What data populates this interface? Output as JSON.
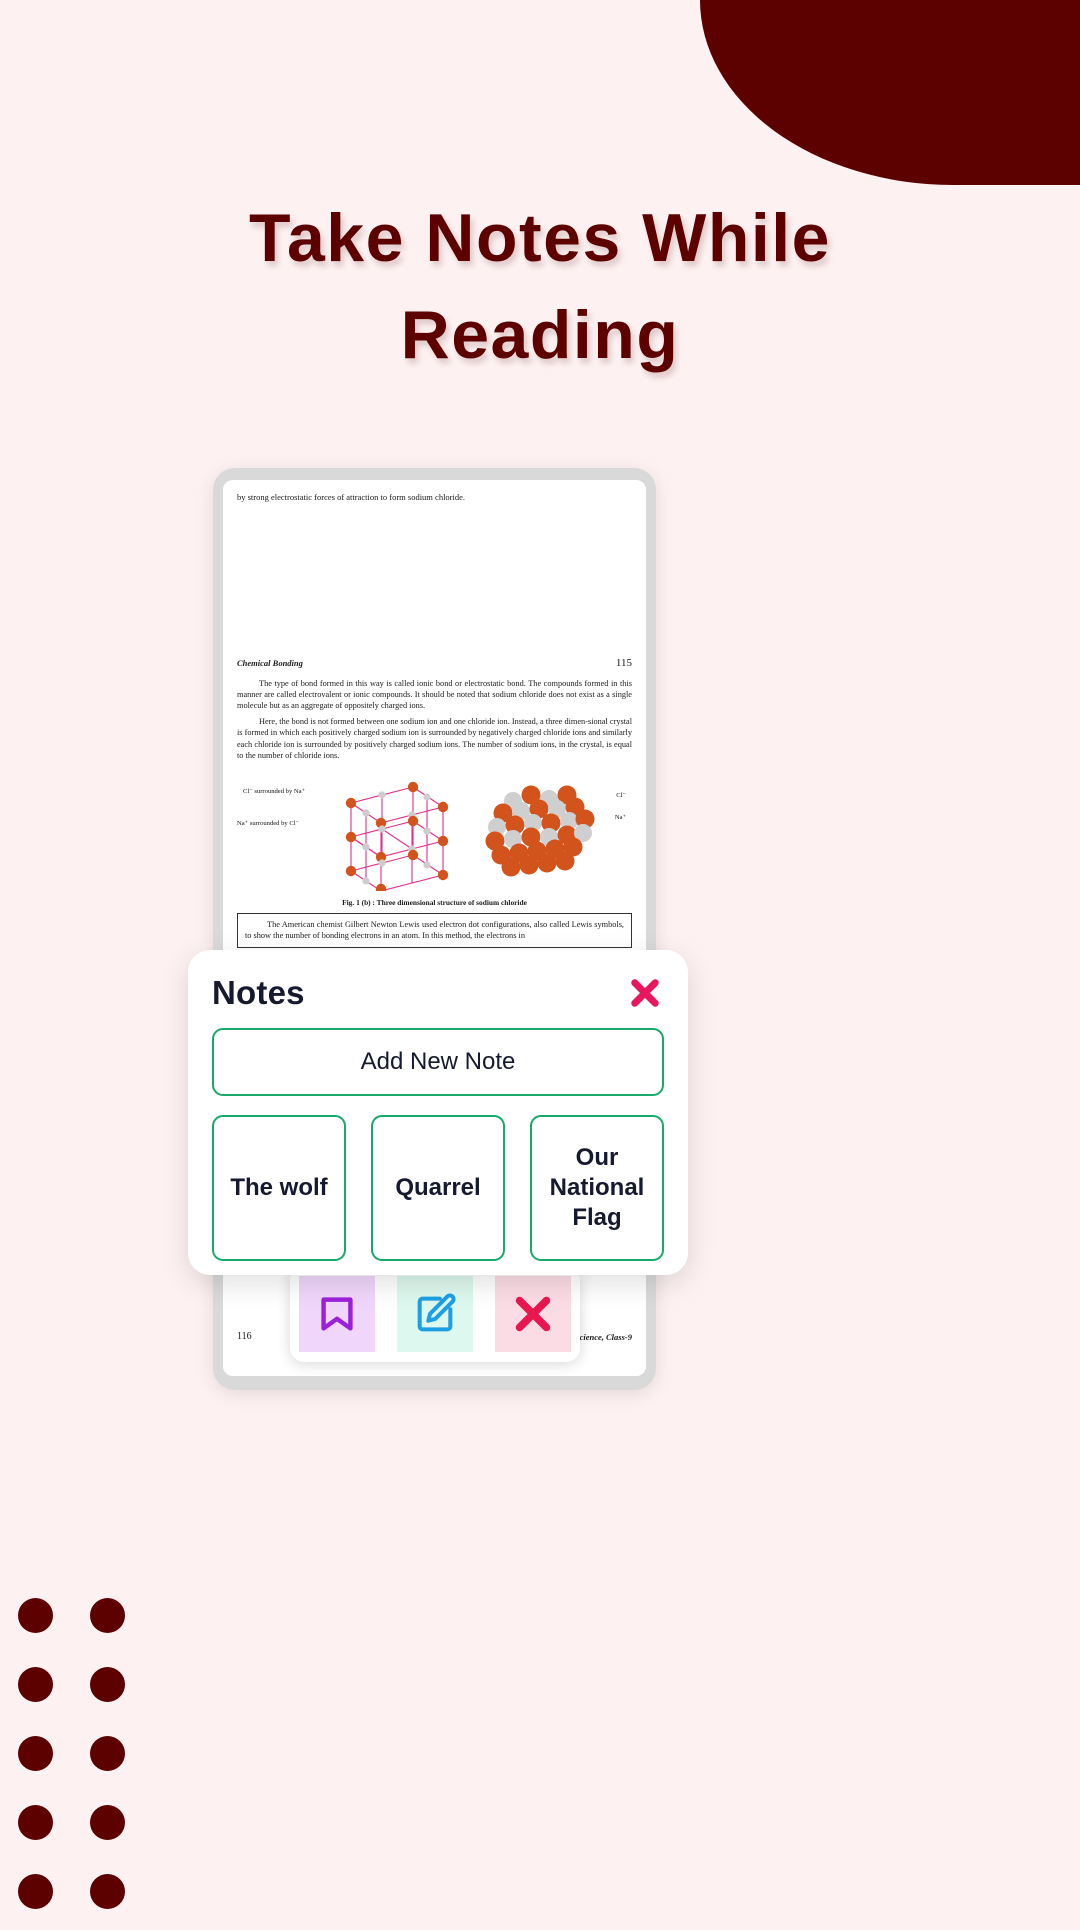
{
  "theme": {
    "background": "#FDF1F1",
    "accent_maroon": "#5C0000",
    "accent_green": "#17AA6B",
    "accent_pink": "#E8175D",
    "text_dark": "#161A2E"
  },
  "headline": {
    "line1": "Take Notes While",
    "line2": "Reading",
    "full": "Take Notes While Reading"
  },
  "phone": {
    "page": {
      "top_line": "by strong electrostatic forces of attraction to form sodium chloride.",
      "running_head": "Chemical Bonding",
      "page_number_top": "115",
      "paragraph1": "The type of bond formed in this way is called ionic bond or electrostatic bond. The compounds formed in this manner are called electrovalent or ionic compounds. It should be noted that sodium chloride does not exist as a single molecule but as an aggregate of oppositely charged ions.",
      "paragraph2": "Here, the bond is not formed between one sodium ion and one chloride ion. Instead, a three dimen-sional crystal is formed in which each positively charged sodium ion is surrounded by negatively charged chloride ions and similarly each chloride ion is surrounded by positively charged sodium ions. The number of sodium ions, in the crystal, is equal to the number of chloride ions.",
      "figure_labels": {
        "left_top": "Cl⁻ surrounded by Na⁺",
        "left_bottom": "Na⁺ surrounded by Cl⁻",
        "right_top": "Cl⁻",
        "right_bottom": "Na⁺"
      },
      "figure_caption": "Fig. 1 (b) : Three dimensional structure of sodium chloride",
      "boxed_text": "The American chemist Gilbert Newton Lewis used electron dot configurations, also called Lewis symbols, to show the number of bonding electrons in an atom. In this method, the electrons in",
      "page_number_bottom": "116",
      "footer_right": "Science, Class-9"
    },
    "toolbar": [
      {
        "name": "bookmark",
        "icon": "bookmark-icon",
        "bg": "#EFD6FA",
        "color": "#9B20D9"
      },
      {
        "name": "edit",
        "icon": "edit-pencil-icon",
        "bg": "#DDF8EE",
        "color": "#1E9FE3"
      },
      {
        "name": "delete",
        "icon": "close-x-icon",
        "bg": "#FBDCE4",
        "color": "#E8174F"
      }
    ]
  },
  "notes_modal": {
    "title": "Notes",
    "close_label": "close-icon",
    "add_button_label": "Add New Note",
    "cards": [
      {
        "label": "The wolf"
      },
      {
        "label": "Quarrel"
      },
      {
        "label": "Our National Flag"
      }
    ]
  },
  "decor": {
    "dot_rows": 5,
    "dot_cols": 2
  }
}
